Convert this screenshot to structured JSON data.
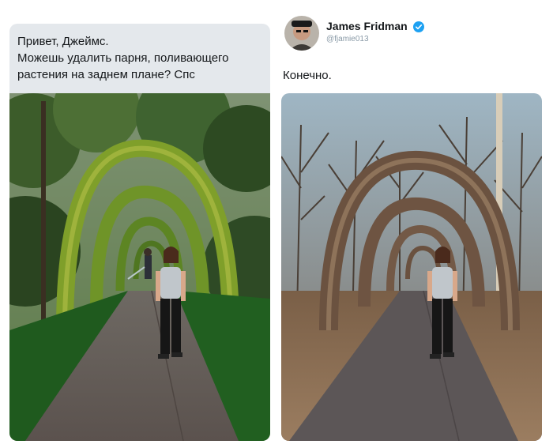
{
  "request": {
    "lines": [
      "Привет, Джеймс.",
      "Можешь удалить парня, поливающего",
      "растения на заднем плане? Спс"
    ]
  },
  "reply": {
    "display_name": "James Fridman",
    "handle": "@fjamie013",
    "text": "Конечно.",
    "verified_icon": "verified-badge-icon"
  },
  "colors": {
    "bubble": "#e4e8ec",
    "verified": "#1da1f2",
    "text": "#14171a",
    "muted": "#8899a6"
  }
}
